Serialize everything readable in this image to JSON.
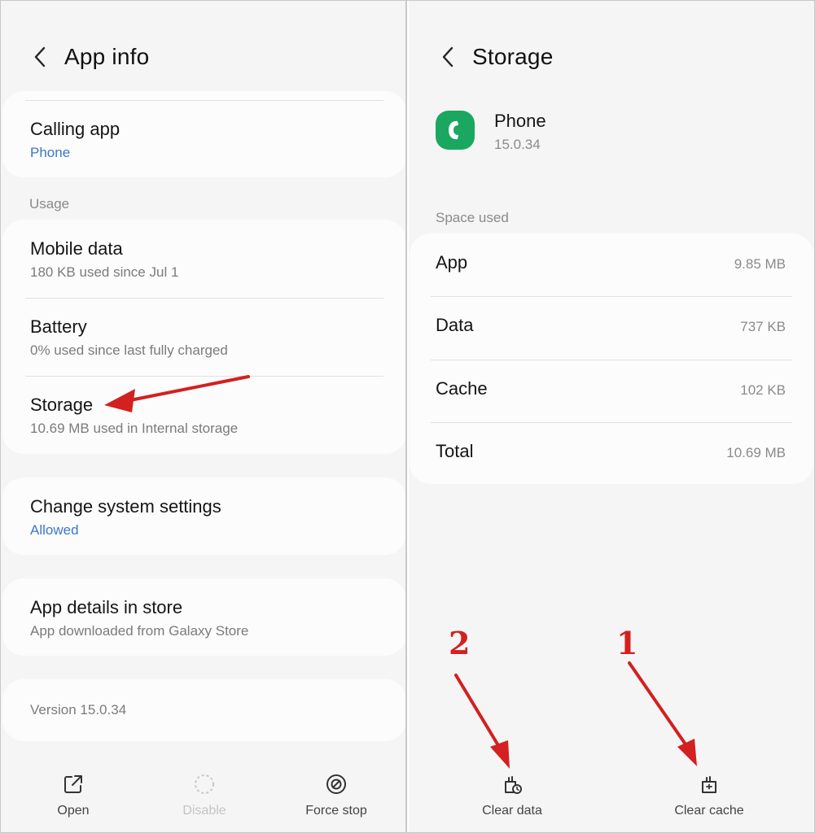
{
  "left": {
    "title": "App info",
    "calling": {
      "label": "Calling app",
      "value": "Phone"
    },
    "usage_label": "Usage",
    "usage_items": [
      {
        "label": "Mobile data",
        "sub": "180 KB used since Jul 1"
      },
      {
        "label": "Battery",
        "sub": "0% used since last fully charged"
      },
      {
        "label": "Storage",
        "sub": "10.69 MB used in Internal storage"
      }
    ],
    "system_settings": {
      "label": "Change system settings",
      "value": "Allowed"
    },
    "store": {
      "label": "App details in store",
      "sub": "App downloaded from Galaxy Store"
    },
    "version": "Version 15.0.34",
    "actions": {
      "open": "Open",
      "disable": "Disable",
      "force_stop": "Force stop"
    }
  },
  "right": {
    "title": "Storage",
    "app": {
      "name": "Phone",
      "version": "15.0.34",
      "icon": "phone-app-icon",
      "color": "#1aa760"
    },
    "space_label": "Space used",
    "space_rows": [
      {
        "label": "App",
        "value": "9.85 MB"
      },
      {
        "label": "Data",
        "value": "737 KB"
      },
      {
        "label": "Cache",
        "value": "102 KB"
      },
      {
        "label": "Total",
        "value": "10.69 MB"
      }
    ],
    "actions": {
      "clear_data": "Clear data",
      "clear_cache": "Clear cache"
    }
  },
  "annotations": {
    "num_clear_data": "2",
    "num_clear_cache": "1",
    "color": "#d32020"
  }
}
